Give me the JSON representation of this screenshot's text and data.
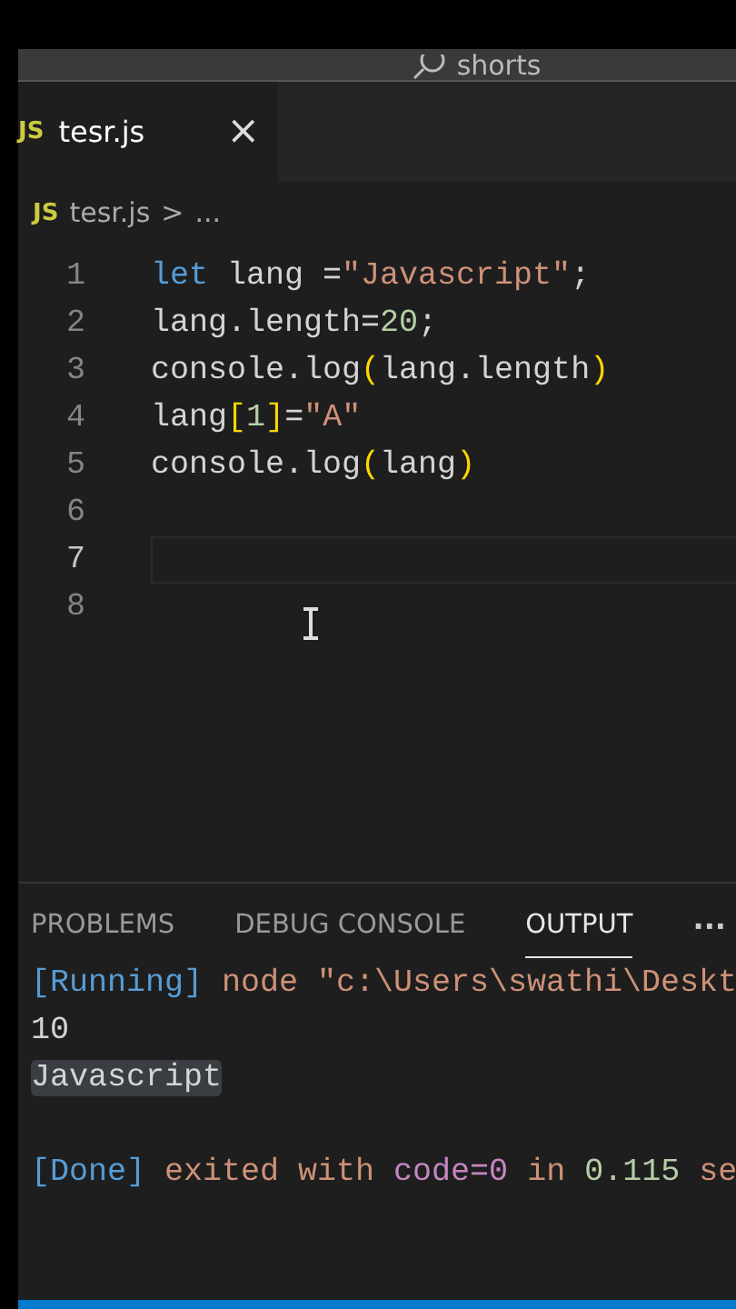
{
  "title_bar": {
    "search": "shorts"
  },
  "tabs": [
    {
      "label": "tesr.js",
      "icon": "JS",
      "selected": true,
      "close": "×"
    }
  ],
  "breadcrumb": {
    "icon": "JS",
    "file": "tesr.js",
    "separator": ">",
    "rest": "..."
  },
  "editor": {
    "lines": [
      {
        "number": "1",
        "selected": false,
        "tokens": [
          {
            "kind": "keyword",
            "text": "let"
          },
          {
            "kind": "plain",
            "text": " lang ="
          },
          {
            "kind": "string",
            "text": "\"Javascript\""
          },
          {
            "kind": "plain",
            "text": ";"
          }
        ]
      },
      {
        "number": "2",
        "selected": false,
        "tokens": [
          {
            "kind": "plain",
            "text": "lang.length="
          },
          {
            "kind": "number",
            "text": "20"
          },
          {
            "kind": "plain",
            "text": ";"
          }
        ]
      },
      {
        "number": "3",
        "selected": false,
        "tokens": [
          {
            "kind": "plain",
            "text": "console.log"
          },
          {
            "kind": "bracket",
            "text": "("
          },
          {
            "kind": "plain",
            "text": "lang.length"
          },
          {
            "kind": "bracket",
            "text": ")"
          }
        ]
      },
      {
        "number": "4",
        "selected": false,
        "tokens": [
          {
            "kind": "plain",
            "text": "lang"
          },
          {
            "kind": "bracket",
            "text": "["
          },
          {
            "kind": "number",
            "text": "1"
          },
          {
            "kind": "bracket",
            "text": "]"
          },
          {
            "kind": "plain",
            "text": "="
          },
          {
            "kind": "string",
            "text": "\"A\""
          }
        ]
      },
      {
        "number": "5",
        "selected": false,
        "tokens": [
          {
            "kind": "plain",
            "text": "console.log"
          },
          {
            "kind": "bracket",
            "text": "("
          },
          {
            "kind": "plain",
            "text": "lang"
          },
          {
            "kind": "bracket",
            "text": ")"
          }
        ]
      },
      {
        "number": "6",
        "selected": false
      },
      {
        "number": "7",
        "selected": true
      },
      {
        "number": "8",
        "selected": false
      }
    ]
  },
  "panel": {
    "tabs": [
      {
        "label": "PROBLEMS",
        "selected": false
      },
      {
        "label": "DEBUG CONSOLE",
        "selected": false
      },
      {
        "label": "OUTPUT",
        "selected": true
      }
    ],
    "more": "···",
    "output": [
      {
        "kind": "text",
        "tokens": [
          {
            "kind": "tag",
            "text": "[Running]"
          },
          {
            "kind": "string",
            "text": " node \"c:\\Users\\swathi\\Deskt"
          }
        ]
      },
      {
        "kind": "text",
        "tokens": [
          {
            "kind": "plain",
            "text": "10"
          }
        ]
      },
      {
        "kind": "text",
        "tokens": [
          {
            "kind": "highlight",
            "text": "Javascript"
          }
        ]
      },
      {
        "kind": "blank"
      },
      {
        "kind": "text",
        "tokens": [
          {
            "kind": "tag",
            "text": "[Done]"
          },
          {
            "kind": "string",
            "text": " exited with "
          },
          {
            "kind": "keyword",
            "text": "code=0"
          },
          {
            "kind": "string",
            "text": " in "
          },
          {
            "kind": "number",
            "text": "0.115"
          },
          {
            "kind": "string",
            "text": " se"
          }
        ]
      }
    ]
  }
}
